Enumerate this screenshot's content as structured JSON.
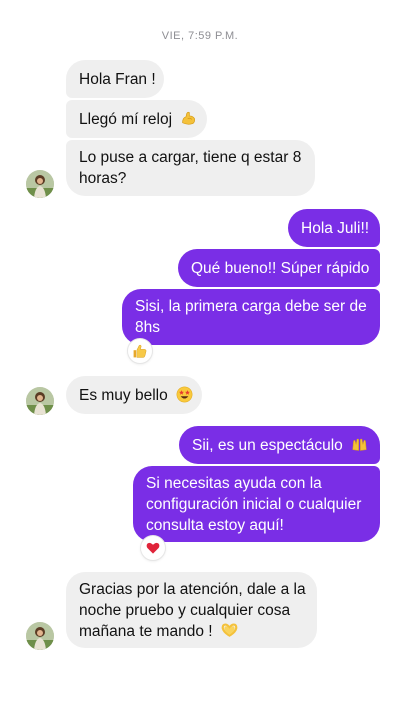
{
  "timestamp": "VIE, 7:59 P.M.",
  "messages": [
    {
      "text": "Hola Fran !"
    },
    {
      "text": "Llegó mí reloj"
    },
    {
      "line1": "Lo puse a cargar, tiene q estar 8",
      "line2": "horas?"
    },
    {
      "text": "Hola Juli!!"
    },
    {
      "text": "Qué bueno!! Súper rápido"
    },
    {
      "line1": "Sisi, la primera carga debe ser de",
      "line2": "8hs"
    },
    {
      "text": "Es muy bello"
    },
    {
      "text": "Sii, es un espectáculo"
    },
    {
      "line1": "Si necesitas ayuda con la",
      "line2": "configuración inicial o cualquier",
      "line3": "consulta estoy aquí!"
    },
    {
      "line1": "Gracias por la atención, dale a la",
      "line2": "noche pruebo y cualquier cosa",
      "line3": "mañana te mando !"
    }
  ],
  "icons": {
    "flexed_biceps": "flexed-biceps-emoji",
    "thumbs_up": "thumbs-up-emoji",
    "star_struck": "star-struck-emoji",
    "raising_hands": "raising-hands-emoji",
    "red_heart": "red-heart-emoji",
    "heart_hands": "heart-hands-emoji"
  },
  "colors": {
    "incoming_bubble": "#efefef",
    "outgoing_bubble": "#7a2ee6",
    "outgoing_text": "#ffffff",
    "timestamp_text": "#8e8e93"
  }
}
